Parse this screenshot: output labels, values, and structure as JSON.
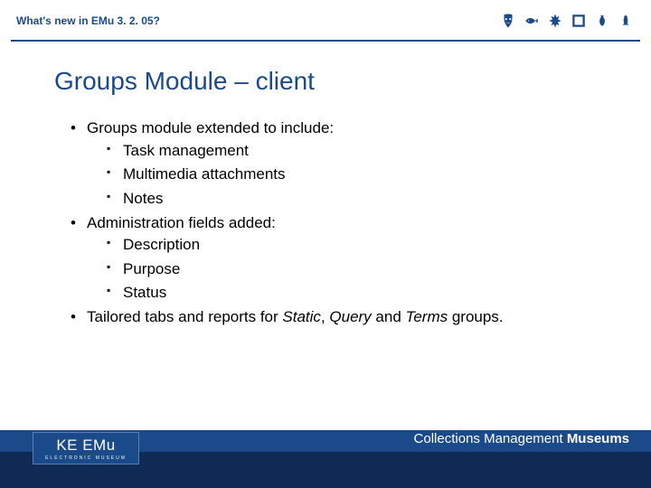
{
  "header": {
    "title": "What's new in EMu 3. 2. 05?"
  },
  "slide": {
    "title_prefix": "Groups Module ",
    "title_suffix": " client"
  },
  "bullets": [
    {
      "text": "Groups module extended to include:",
      "children": [
        "Task management",
        "Multimedia attachments",
        "Notes"
      ]
    },
    {
      "text": "Administration fields added:",
      "children": [
        "Description",
        "Purpose",
        "Status"
      ]
    },
    {
      "text_parts": [
        {
          "t": "Tailored tabs and reports for "
        },
        {
          "t": "Static",
          "italic": true
        },
        {
          "t": ", "
        },
        {
          "t": "Query",
          "italic": true
        },
        {
          "t": " and "
        },
        {
          "t": "Terms",
          "italic": true
        },
        {
          "t": " groups."
        }
      ]
    }
  ],
  "footer": {
    "logo_main": "KE EMu",
    "logo_sub": "ELECTRONIC MUSEUM",
    "tagline_prefix": "Collections Management ",
    "tagline_bold": "Museums"
  }
}
